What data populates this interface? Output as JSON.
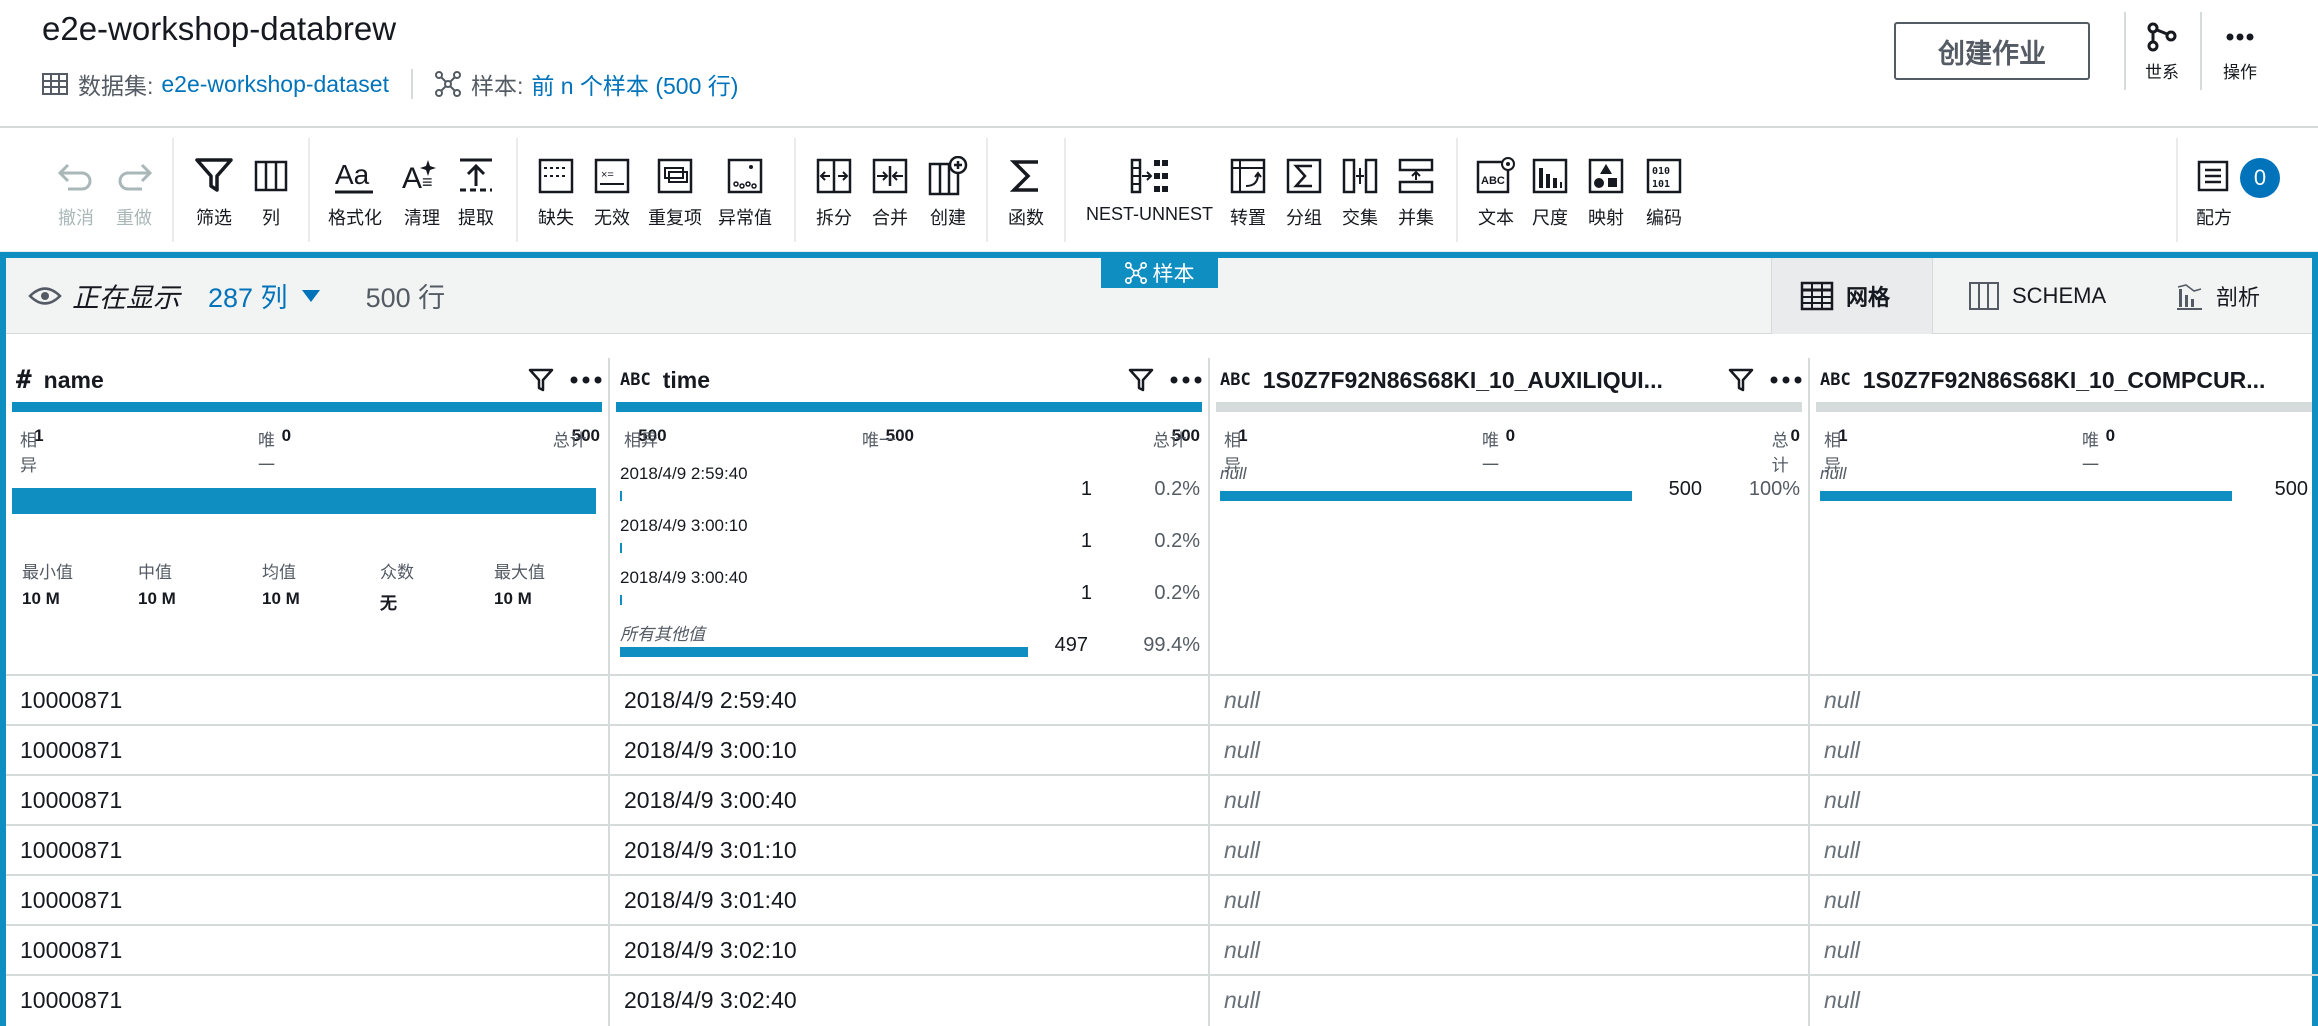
{
  "header": {
    "title": "e2e-workshop-databrew",
    "dataset_label": "数据集:",
    "dataset_name": "e2e-workshop-dataset",
    "sample_label": "样本:",
    "sample_value": "前 n 个样本 (500 行)",
    "create_job": "创建作业",
    "lineage": "世系",
    "actions": "操作"
  },
  "toolbar": {
    "undo": "撤消",
    "redo": "重做",
    "filter": "筛选",
    "column": "列",
    "format": "格式化",
    "clean": "清理",
    "extract": "提取",
    "missing": "缺失",
    "invalid": "无效",
    "duplicates": "重复项",
    "outliers": "异常值",
    "split": "拆分",
    "merge": "合并",
    "create": "创建",
    "functions": "函数",
    "nest_unnest": "NEST-UNNEST",
    "pivot": "转置",
    "group": "分组",
    "join": "交集",
    "union": "并集",
    "text": "文本",
    "scale": "尺度",
    "mapping": "映射",
    "encode": "编码",
    "recipe": "配方",
    "recipe_count": "0"
  },
  "view": {
    "showing_label": "正在显示",
    "columns": "287 列",
    "rows": "500 行",
    "sample_tag": "样本",
    "tab_grid": "网格",
    "tab_schema": "SCHEMA",
    "tab_profile": "剖析"
  },
  "labels": {
    "distinct": "相异",
    "unique": "唯一",
    "total": "总计",
    "min": "最小值",
    "median": "中值",
    "mean": "均值",
    "mode": "众数",
    "max": "最大值",
    "others": "所有其他值",
    "null_word": "null"
  },
  "columns": [
    {
      "type": "#",
      "name": "name",
      "distinct": "1",
      "unique": "0",
      "total": "500",
      "min": "10 M",
      "median": "10 M",
      "mean": "10 M",
      "mode": "无",
      "max": "10 M"
    },
    {
      "type": "ABC",
      "name": "time",
      "distinct": "500",
      "unique": "500",
      "total": "500",
      "top_values": [
        {
          "label": "2018/4/9 2:59:40",
          "count": "1",
          "pct": "0.2%"
        },
        {
          "label": "2018/4/9 3:00:10",
          "count": "1",
          "pct": "0.2%"
        },
        {
          "label": "2018/4/9 3:00:40",
          "count": "1",
          "pct": "0.2%"
        },
        {
          "label": "所有其他值",
          "count": "497",
          "pct": "99.4%"
        }
      ]
    },
    {
      "type": "ABC",
      "name": "1S0Z7F92N86S68KI_10_AUXILIQUI...",
      "distinct": "1",
      "unique": "0",
      "total": "0",
      "top_values": [
        {
          "label": "null",
          "count": "500",
          "pct": "100%"
        }
      ]
    },
    {
      "type": "ABC",
      "name": "1S0Z7F92N86S68KI_10_COMPCUR...",
      "distinct": "1",
      "unique": "0",
      "top_values": [
        {
          "label": "null",
          "count": "500"
        }
      ]
    }
  ],
  "rows": [
    [
      "10000871",
      "2018/4/9 2:59:40",
      "null",
      "null"
    ],
    [
      "10000871",
      "2018/4/9 3:00:10",
      "null",
      "null"
    ],
    [
      "10000871",
      "2018/4/9 3:00:40",
      "null",
      "null"
    ],
    [
      "10000871",
      "2018/4/9 3:01:10",
      "null",
      "null"
    ],
    [
      "10000871",
      "2018/4/9 3:01:40",
      "null",
      "null"
    ],
    [
      "10000871",
      "2018/4/9 3:02:10",
      "null",
      "null"
    ],
    [
      "10000871",
      "2018/4/9 3:02:40",
      "null",
      "null"
    ]
  ],
  "colors": {
    "accent": "#0f8ec2",
    "link": "#0073bb",
    "quality_full": "#0f8ec2",
    "quality_empty": "#d5dbdb"
  }
}
